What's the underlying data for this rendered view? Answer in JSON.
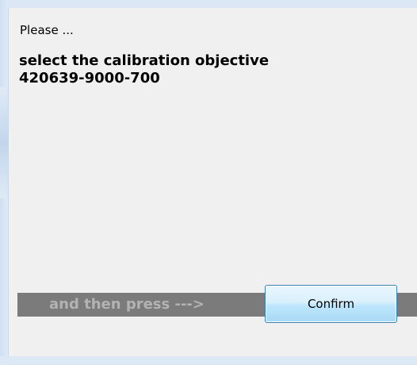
{
  "dialog": {
    "title_label": "Please ...",
    "message_lines": [
      "select the calibration objective",
      "420639-9000-700"
    ]
  },
  "action_bar": {
    "instruction": "and then press  --->",
    "confirm_label": "Confirm"
  }
}
